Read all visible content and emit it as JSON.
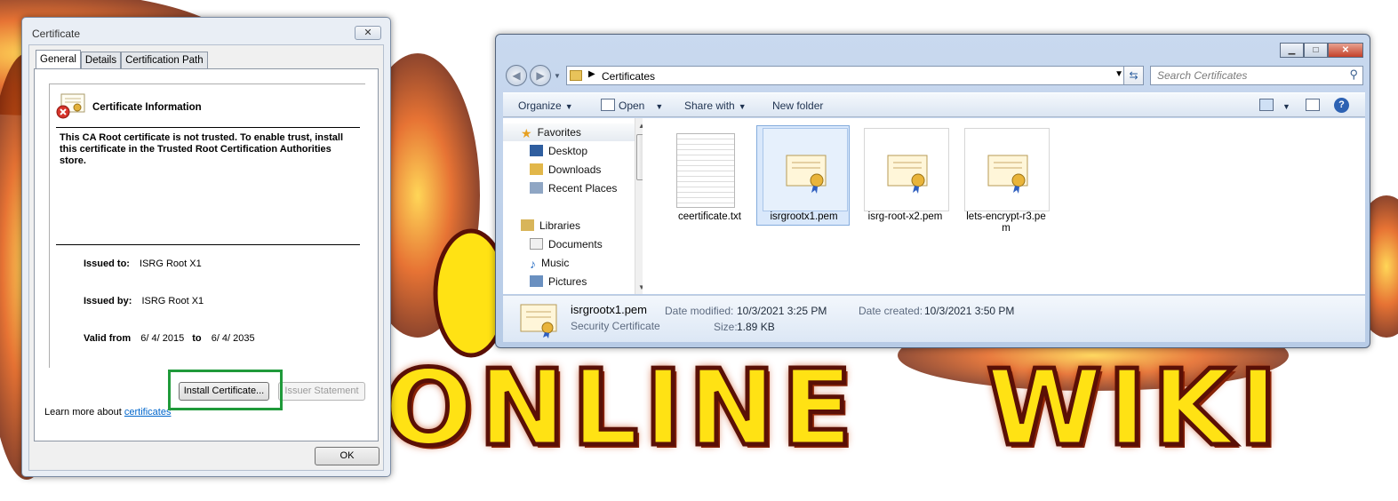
{
  "background": {
    "word1": "ONLINE",
    "word2": "WIKI"
  },
  "cert_dialog": {
    "title": "Certificate",
    "close_glyph": "✕",
    "tabs": [
      "General",
      "Details",
      "Certification Path"
    ],
    "heading": "Certificate Information",
    "message": "This CA Root certificate is not trusted. To enable trust, install this certificate in the Trusted Root Certification Authorities store.",
    "issued_to_label": "Issued to:",
    "issued_to_value": "ISRG Root X1",
    "issued_by_label": "Issued by:",
    "issued_by_value": "ISRG Root X1",
    "valid_from_label": "Valid from",
    "valid_from_value": "6/ 4/ 2015",
    "valid_to_label": "to",
    "valid_to_value": "6/ 4/ 2035",
    "install_button": "Install Certificate...",
    "issuer_button": "Issuer Statement",
    "learn_more_prefix": "Learn more about ",
    "learn_more_link": "certificates",
    "ok_button": "OK"
  },
  "explorer": {
    "window_buttons": {
      "minimize": "▁",
      "maximize": "□",
      "close": "✕"
    },
    "address_path": "Certificates",
    "search_placeholder": "Search Certificates",
    "toolbar": {
      "organize": "Organize",
      "open": "Open",
      "share_with": "Share with",
      "new_folder": "New folder"
    },
    "nav": {
      "favorites": "Favorites",
      "desktop": "Desktop",
      "downloads": "Downloads",
      "recent_places": "Recent Places",
      "libraries": "Libraries",
      "documents": "Documents",
      "music": "Music",
      "pictures": "Pictures"
    },
    "files": [
      {
        "name": "ceertificate.txt",
        "type": "txt",
        "selected": false
      },
      {
        "name": "isrgrootx1.pem",
        "type": "cert",
        "selected": true
      },
      {
        "name": "isrg-root-x2.pem",
        "type": "cert",
        "selected": false
      },
      {
        "name": "lets-encrypt-r3.pem",
        "type": "cert",
        "selected": false
      }
    ],
    "details": {
      "name": "isrgrootx1.pem",
      "type": "Security Certificate",
      "modified_label": "Date modified:",
      "modified_value": "10/3/2021 3:25 PM",
      "size_label": "Size:",
      "size_value": "1.89 KB",
      "created_label": "Date created:",
      "created_value": "10/3/2021 3:50 PM"
    }
  },
  "colors": {
    "highlight_box": "#1f9a3a",
    "link": "#0066cc",
    "selection": "#d9e8fb"
  }
}
